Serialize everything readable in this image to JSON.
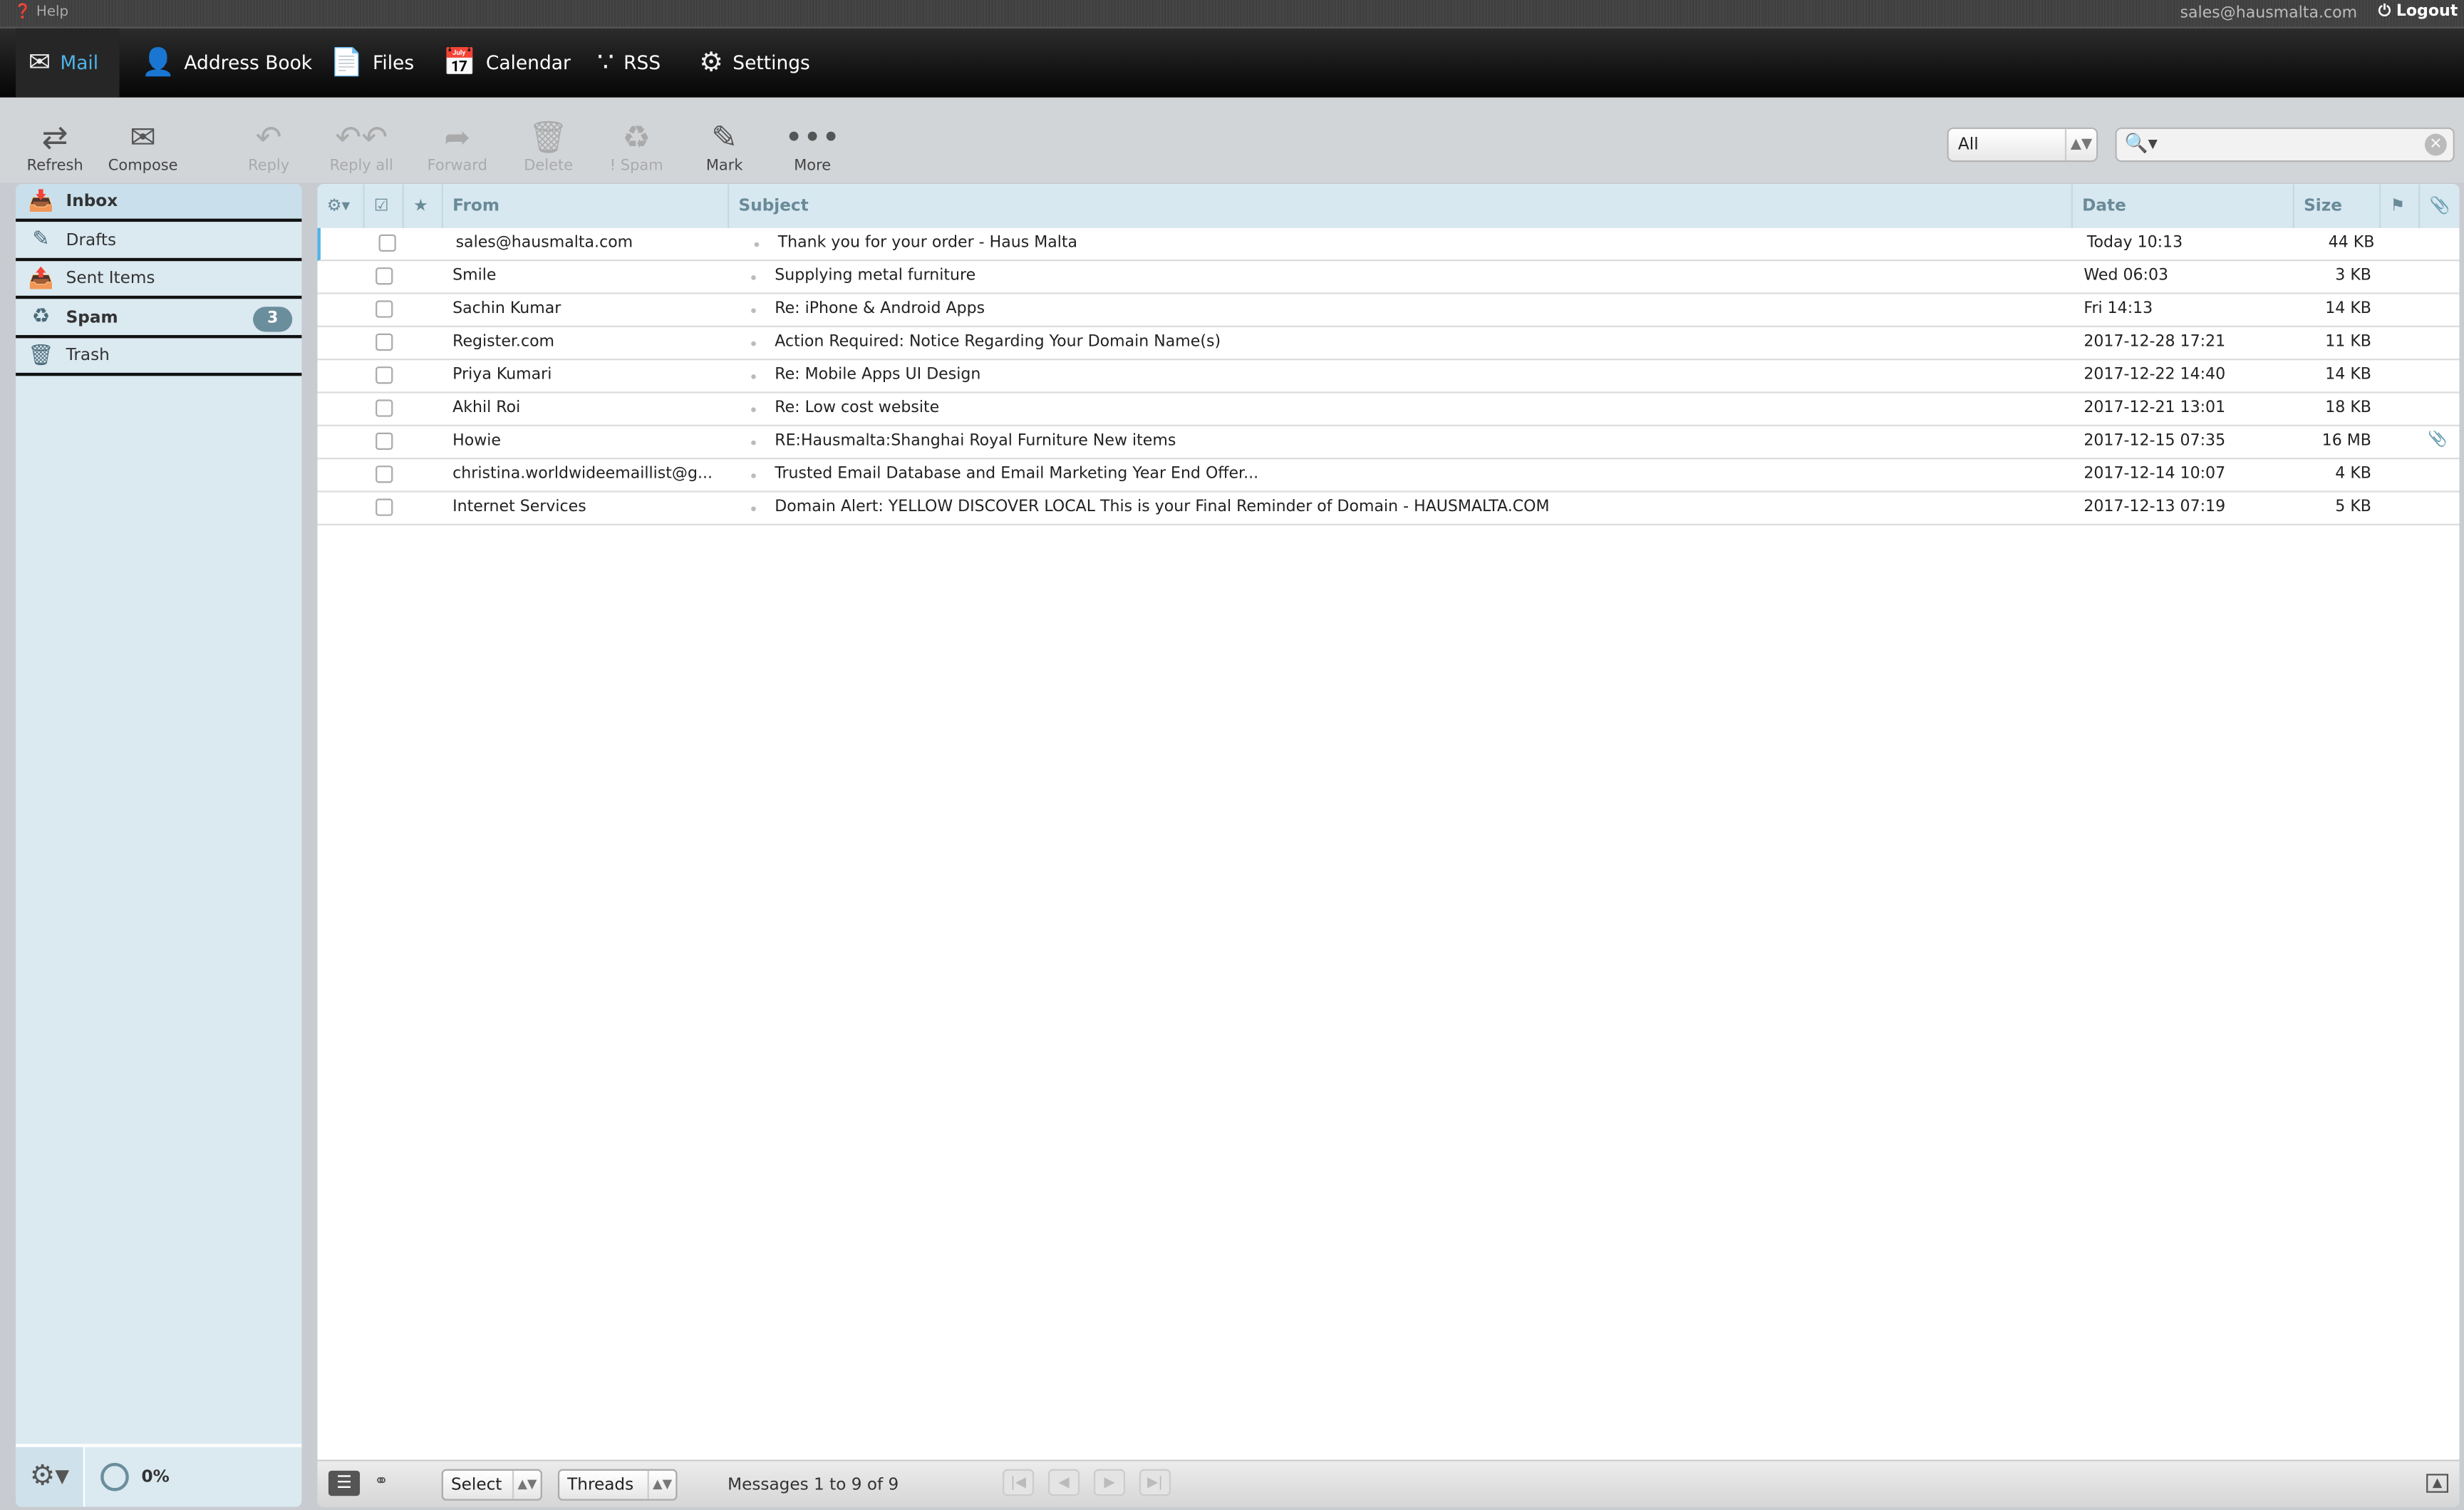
{
  "topbar": {
    "help": "Help",
    "user": "sales@hausmalta.com",
    "logout": "Logout"
  },
  "nav": [
    {
      "label": "Mail",
      "icon": "envelope-icon"
    },
    {
      "label": "Address Book",
      "icon": "person-icon"
    },
    {
      "label": "Files",
      "icon": "file-icon"
    },
    {
      "label": "Calendar",
      "icon": "calendar-icon"
    },
    {
      "label": "RSS",
      "icon": "rss-icon"
    },
    {
      "label": "Settings",
      "icon": "gear-icon"
    }
  ],
  "toolbar": {
    "refresh": "Refresh",
    "compose": "Compose",
    "reply": "Reply",
    "reply_all": "Reply all",
    "forward": "Forward",
    "delete": "Delete",
    "spam": "Spam",
    "mark": "Mark",
    "more": "More"
  },
  "filter": {
    "value": "All"
  },
  "search": {
    "placeholder": ""
  },
  "folders": [
    {
      "label": "Inbox",
      "selected": true
    },
    {
      "label": "Drafts"
    },
    {
      "label": "Sent Items"
    },
    {
      "label": "Spam",
      "badge": "3"
    },
    {
      "label": "Trash"
    }
  ],
  "quota": "0%",
  "columns": {
    "from": "From",
    "subject": "Subject",
    "date": "Date",
    "size": "Size"
  },
  "messages": [
    {
      "from": "sales@hausmalta.com",
      "subject": "Thank you for your order - Haus Malta",
      "date": "Today 10:13",
      "size": "44 KB"
    },
    {
      "from": "Smile",
      "subject": "Supplying metal furniture",
      "date": "Wed 06:03",
      "size": "3 KB"
    },
    {
      "from": "Sachin Kumar",
      "subject": "Re: iPhone & Android Apps",
      "date": "Fri 14:13",
      "size": "14 KB"
    },
    {
      "from": "Register.com",
      "subject": "Action Required: Notice Regarding Your Domain Name(s)",
      "date": "2017-12-28 17:21",
      "size": "11 KB"
    },
    {
      "from": "Priya Kumari",
      "subject": "Re: Mobile Apps UI Design",
      "date": "2017-12-22 14:40",
      "size": "14 KB"
    },
    {
      "from": "Akhil Roi",
      "subject": "Re: Low cost website",
      "date": "2017-12-21 13:01",
      "size": "18 KB"
    },
    {
      "from": "Howie",
      "subject": "RE:Hausmalta:Shanghai Royal Furniture New items",
      "date": "2017-12-15 07:35",
      "size": "16 MB",
      "attachment": true
    },
    {
      "from": "christina.worldwideemaillist@g...",
      "subject": "Trusted Email Database and Email Marketing Year End Offer...",
      "date": "2017-12-14 10:07",
      "size": "4 KB"
    },
    {
      "from": "Internet Services",
      "subject": "Domain Alert: YELLOW DISCOVER LOCAL This is your Final Reminder of Domain - HAUSMALTA.COM",
      "date": "2017-12-13 07:19",
      "size": "5 KB"
    }
  ],
  "footer": {
    "select": "Select",
    "threads": "Threads",
    "count": "Messages 1 to 9 of 9"
  },
  "colors": {
    "accent": "#4fb4e8",
    "sidebar": "#dbe9f1",
    "header": "#d7e8f1"
  }
}
